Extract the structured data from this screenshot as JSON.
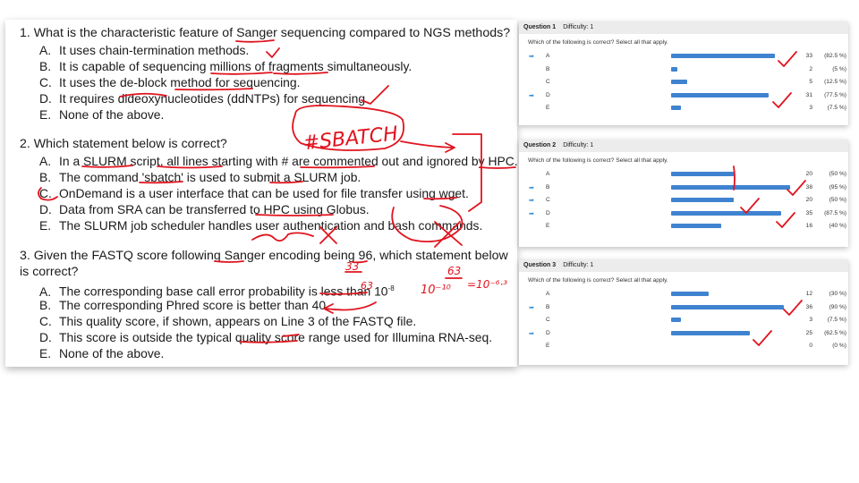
{
  "quiz": [
    {
      "question": "1. What is the characteristic feature of Sanger sequencing compared to NGS methods?",
      "options": [
        {
          "letter": "A.",
          "text": "It uses chain-termination methods."
        },
        {
          "letter": "B.",
          "text": "It is capable of sequencing millions of fragments simultaneously."
        },
        {
          "letter": "C.",
          "text": "It uses the de-block method for sequencing."
        },
        {
          "letter": "D.",
          "text": "It requires dideoxynucleotides (ddNTPs) for sequencing."
        },
        {
          "letter": "E.",
          "text": "None of the above."
        }
      ]
    },
    {
      "question": "2. Which statement below is correct?",
      "options": [
        {
          "letter": "A.",
          "text": "In a SLURM script, all lines starting with # are commented out and ignored by HPC."
        },
        {
          "letter": "B.",
          "text": "The command 'sbatch' is used to submit a SLURM job."
        },
        {
          "letter": "C.",
          "text": "OnDemand is a user interface that can be used for file transfer using wget."
        },
        {
          "letter": "D.",
          "text": "Data from SRA can be transferred to HPC using Globus."
        },
        {
          "letter": "E.",
          "text": "The SLURM job scheduler handles user authentication and bash commands."
        }
      ]
    },
    {
      "question": "3. Given the FASTQ score following Sanger encoding being 96, which statement below is correct?",
      "options": [
        {
          "letter": "A.",
          "text": "The corresponding base call error probability is less than 10"
        },
        {
          "letter": "B.",
          "text": "The corresponding Phred score is better than 40."
        },
        {
          "letter": "C.",
          "text": "This quality score, if shown, appears on Line 3 of the FASTQ file."
        },
        {
          "letter": "D.",
          "text": "This score is outside the typical quality score range used for Illumina RNA-seq."
        },
        {
          "letter": "E.",
          "text": "None of the above."
        }
      ],
      "exponent": "-8"
    }
  ],
  "results": [
    {
      "title": "Question 1",
      "difficulty": "Difficulty: 1",
      "instruction": "Which of the following is correct? Select all that apply.",
      "rows": [
        {
          "label": "A",
          "count": "33",
          "percent": "(82.5 %)",
          "fraction": 0.825,
          "correct": true
        },
        {
          "label": "B",
          "count": "2",
          "percent": "(5 %)",
          "fraction": 0.05,
          "correct": false
        },
        {
          "label": "C",
          "count": "5",
          "percent": "(12.5 %)",
          "fraction": 0.125,
          "correct": false
        },
        {
          "label": "D",
          "count": "31",
          "percent": "(77.5 %)",
          "fraction": 0.775,
          "correct": true
        },
        {
          "label": "E",
          "count": "3",
          "percent": "(7.5 %)",
          "fraction": 0.075,
          "correct": false
        }
      ]
    },
    {
      "title": "Question 2",
      "difficulty": "Difficulty: 1",
      "instruction": "Which of the following is correct? Select all that apply.",
      "rows": [
        {
          "label": "A",
          "count": "20",
          "percent": "(50 %)",
          "fraction": 0.5,
          "correct": false
        },
        {
          "label": "B",
          "count": "38",
          "percent": "(95 %)",
          "fraction": 0.95,
          "correct": true
        },
        {
          "label": "C",
          "count": "20",
          "percent": "(50 %)",
          "fraction": 0.5,
          "correct": true
        },
        {
          "label": "D",
          "count": "35",
          "percent": "(87.5 %)",
          "fraction": 0.875,
          "correct": true
        },
        {
          "label": "E",
          "count": "16",
          "percent": "(40 %)",
          "fraction": 0.4,
          "correct": false
        }
      ]
    },
    {
      "title": "Question 3",
      "difficulty": "Difficulty: 1",
      "instruction": "Which of the following is correct? Select all that apply.",
      "rows": [
        {
          "label": "A",
          "count": "12",
          "percent": "(30 %)",
          "fraction": 0.3,
          "correct": false
        },
        {
          "label": "B",
          "count": "36",
          "percent": "(90 %)",
          "fraction": 0.9,
          "correct": true
        },
        {
          "label": "C",
          "count": "3",
          "percent": "(7.5 %)",
          "fraction": 0.075,
          "correct": false
        },
        {
          "label": "D",
          "count": "25",
          "percent": "(62.5 %)",
          "fraction": 0.625,
          "correct": true
        },
        {
          "label": "E",
          "count": "0",
          "percent": "(0 %)",
          "fraction": 0,
          "correct": false
        }
      ]
    }
  ],
  "annotations": {
    "sbatch_note": "#SBATCH",
    "num_33": "33",
    "num_63": "63",
    "calc": "10⁻¹⁰",
    "calc2": "=10⁻⁶·³",
    "exp": "-6.3"
  },
  "colors": {
    "bar": "#3f83d0",
    "ink": "#e0141e",
    "arrow": "#3a8fd6"
  }
}
